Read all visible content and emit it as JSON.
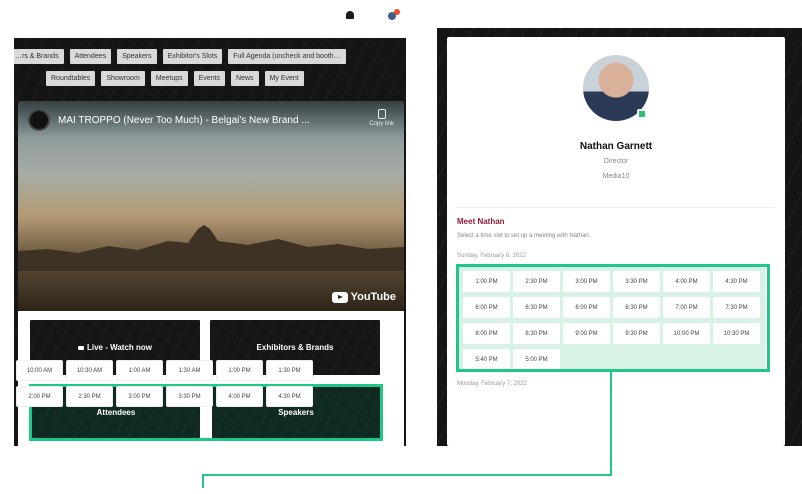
{
  "left": {
    "tags_row1": [
      "…rs & Brands",
      "Attendees",
      "Speakers",
      "Exhibitor's Slots",
      "Full Agenda (uncheck and booth…"
    ],
    "tags_row2": [
      "Roundtables",
      "Showroom",
      "Meetups",
      "Events",
      "News",
      "My Event"
    ],
    "video": {
      "title": "MAI TROPPO (Never Too Much) - Belgai's New Brand ...",
      "copy_label": "Copy link",
      "youtube_label": "YouTube"
    },
    "buttons": {
      "live": "Live - Watch now",
      "exhibitors": "Exhibitors & Brands",
      "attendees": "Attendees",
      "speakers": "Speakers"
    }
  },
  "profile": {
    "name": "Nathan Garnett",
    "role": "Director",
    "company": "Media10",
    "meet_title": "Meet Nathan",
    "meet_desc": "Select a time slot to set up a meeting with Nathan.",
    "date1": "Sunday, February 6, 2022",
    "slots1": [
      "1:00 PM",
      "2:30 PM",
      "3:00 PM",
      "3:30 PM",
      "4:00 PM",
      "4:30 PM",
      "6:00 PM",
      "6:30 PM",
      "6:00 PM",
      "6:30 PM",
      "7:00 PM",
      "7:30 PM",
      "8:00 PM",
      "8:30 PM",
      "9:00 PM",
      "9:30 PM",
      "10:00 PM",
      "10:30 PM",
      "5:40 PM",
      "5:00 PM"
    ],
    "date2": "Monday, February 7, 2022",
    "slots2": [
      "10:00 AM",
      "10:30 AM",
      "1:00 AM",
      "1:30 AM",
      "1:00 PM",
      "1:30 PM",
      "2:00 PM",
      "2:30 PM",
      "3:00 PM",
      "3:30 PM",
      "4:00 PM",
      "4:30 PM"
    ]
  },
  "colors": {
    "highlight": "#1fc888",
    "accent_title": "#8b1d3a",
    "slot_bg": "#d8f2e6"
  }
}
